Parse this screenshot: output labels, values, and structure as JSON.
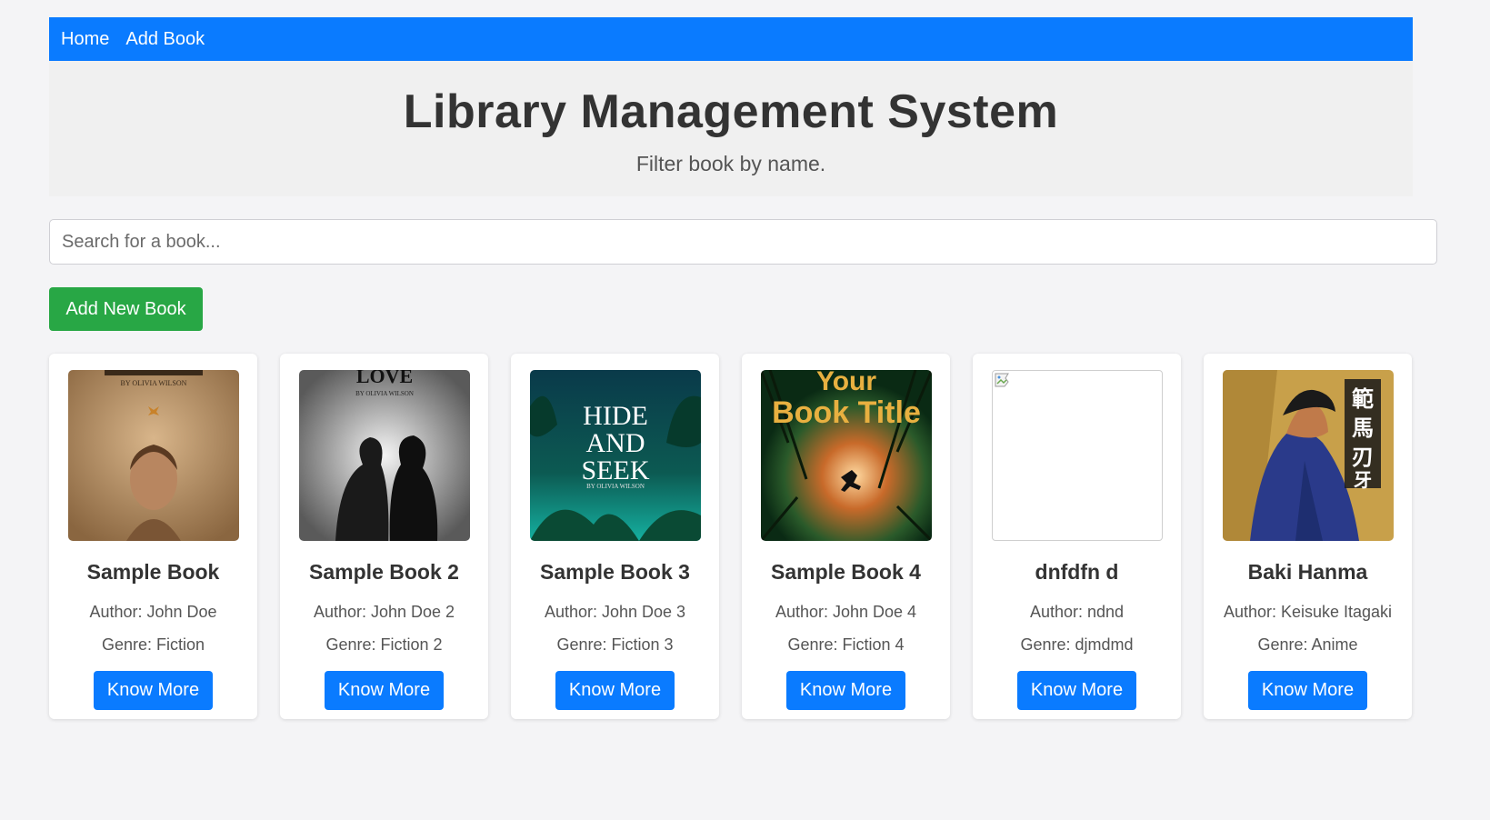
{
  "nav": {
    "home": "Home",
    "add_book": "Add Book"
  },
  "header": {
    "title": "Library Management System",
    "subtitle": "Filter book by name."
  },
  "search": {
    "placeholder": "Search for a book...",
    "value": ""
  },
  "add_new_book": "Add New Book",
  "colors": {
    "primary": "#0a7bff",
    "success": "#28a745",
    "header_bg": "#f0f0f0",
    "page_bg": "#f4f4f6"
  },
  "books": [
    {
      "title": "Sample Book",
      "author": "Author: John Doe",
      "genre": "Genre: Fiction",
      "button": "Know More",
      "cover_text": "BY OLIVIA WILSON"
    },
    {
      "title": "Sample Book 2",
      "author": "Author: John Doe 2",
      "genre": "Genre: Fiction 2",
      "button": "Know More",
      "cover_text": "LOVE",
      "cover_sub": "BY OLIVIA WILSON"
    },
    {
      "title": "Sample Book 3",
      "author": "Author: John Doe 3",
      "genre": "Genre: Fiction 3",
      "button": "Know More",
      "cover_text": "HIDE AND SEEK",
      "cover_sub": "BY OLIVIA WILSON"
    },
    {
      "title": "Sample Book 4",
      "author": "Author: John Doe 4",
      "genre": "Genre: Fiction 4",
      "button": "Know More",
      "cover_text": "Your Book Title"
    },
    {
      "title": "dnfdfn d",
      "author": "Author: ndnd",
      "genre": "Genre: djmdmd",
      "button": "Know More"
    },
    {
      "title": "Baki Hanma",
      "author": "Author: Keisuke Itagaki",
      "genre": "Genre: Anime",
      "button": "Know More"
    }
  ]
}
